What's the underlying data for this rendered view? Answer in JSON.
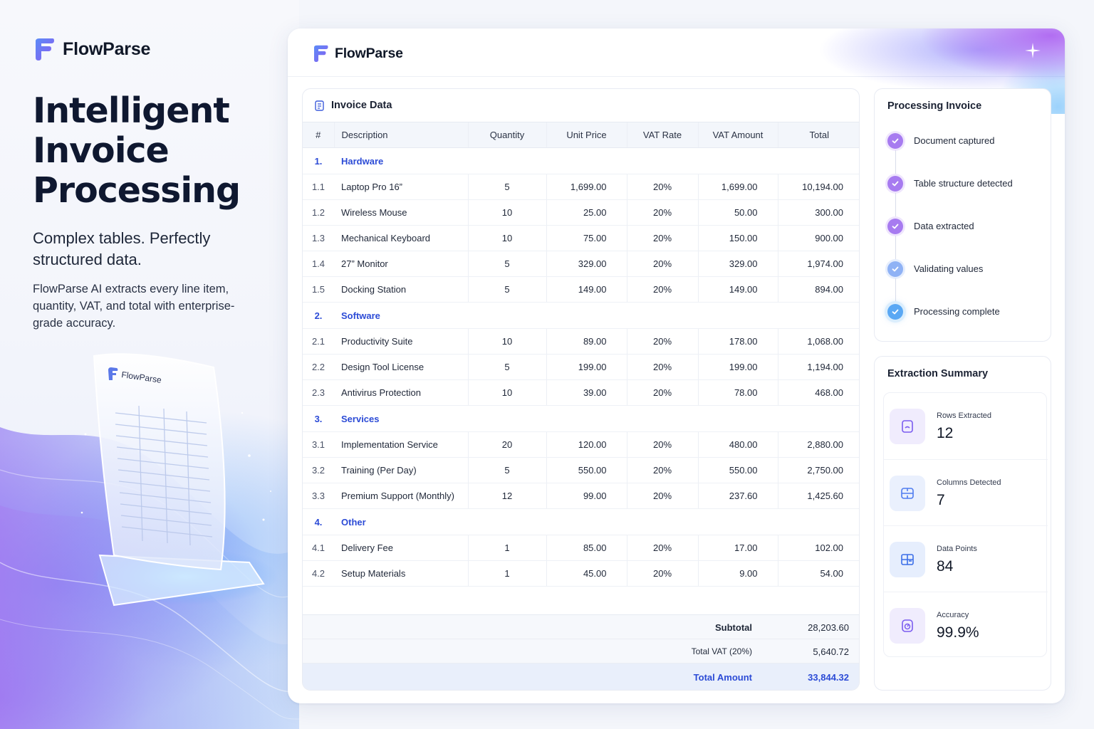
{
  "hero": {
    "brand": "FlowParse",
    "title_lines": [
      "Intelligent",
      "Invoice",
      "Processing"
    ],
    "subtitle": "Complex tables. Perfectly structured data.",
    "description": "FlowParse AI extracts every line item, quantity, VAT, and total with enterprise-grade accuracy.",
    "illustration_brand": "FlowParse"
  },
  "app": {
    "brand": "FlowParse"
  },
  "invoice": {
    "title": "Invoice Data",
    "columns": [
      "#",
      "Description",
      "Quantity",
      "Unit Price",
      "VAT Rate",
      "VAT Amount",
      "Total"
    ],
    "sections": [
      {
        "num": "1.",
        "name": "Hardware",
        "rows": [
          [
            "1.1",
            "Laptop Pro 16”",
            "5",
            "1,699.00",
            "20%",
            "1,699.00",
            "10,194.00"
          ],
          [
            "1.2",
            "Wireless Mouse",
            "10",
            "25.00",
            "20%",
            "50.00",
            "300.00"
          ],
          [
            "1.3",
            "Mechanical Keyboard",
            "10",
            "75.00",
            "20%",
            "150.00",
            "900.00"
          ],
          [
            "1.4",
            "27” Monitor",
            "5",
            "329.00",
            "20%",
            "329.00",
            "1,974.00"
          ],
          [
            "1.5",
            "Docking Station",
            "5",
            "149.00",
            "20%",
            "149.00",
            "894.00"
          ]
        ]
      },
      {
        "num": "2.",
        "name": "Software",
        "rows": [
          [
            "2.1",
            "Productivity Suite",
            "10",
            "89.00",
            "20%",
            "178.00",
            "1,068.00"
          ],
          [
            "2.2",
            "Design Tool License",
            "5",
            "199.00",
            "20%",
            "199.00",
            "1,194.00"
          ],
          [
            "2.3",
            "Antivirus Protection",
            "10",
            "39.00",
            "20%",
            "78.00",
            "468.00"
          ]
        ]
      },
      {
        "num": "3.",
        "name": "Services",
        "rows": [
          [
            "3.1",
            "Implementation Service",
            "20",
            "120.00",
            "20%",
            "480.00",
            "2,880.00"
          ],
          [
            "3.2",
            "Training (Per Day)",
            "5",
            "550.00",
            "20%",
            "550.00",
            "2,750.00"
          ],
          [
            "3.3",
            "Premium Support (Monthly)",
            "12",
            "99.00",
            "20%",
            "237.60",
            "1,425.60"
          ]
        ]
      },
      {
        "num": "4.",
        "name": "Other",
        "rows": [
          [
            "4.1",
            "Delivery Fee",
            "1",
            "85.00",
            "20%",
            "17.00",
            "102.00"
          ],
          [
            "4.2",
            "Setup Materials",
            "1",
            "45.00",
            "20%",
            "9.00",
            "54.00"
          ]
        ]
      }
    ],
    "subtotal_label": "Subtotal",
    "subtotal_value": "28,203.60",
    "vat_label": "Total VAT (20%)",
    "vat_value": "5,640.72",
    "total_label": "Total Amount",
    "total_value": "33,844.32"
  },
  "processing": {
    "title": "Processing Invoice",
    "steps": [
      {
        "label": "Document captured",
        "state": "done",
        "icon": "check-icon"
      },
      {
        "label": "Table structure detected",
        "state": "done",
        "icon": "check-icon"
      },
      {
        "label": "Data extracted",
        "state": "done",
        "icon": "check-icon"
      },
      {
        "label": "Validating values",
        "state": "done",
        "icon": "check-icon"
      },
      {
        "label": "Processing complete",
        "state": "active",
        "icon": "check-icon"
      }
    ]
  },
  "summary": {
    "title": "Extraction Summary",
    "metrics": [
      {
        "label": "Rows Extracted",
        "value": "12",
        "icon": "rows-icon"
      },
      {
        "label": "Columns Detected",
        "value": "7",
        "icon": "columns-icon"
      },
      {
        "label": "Data Points",
        "value": "84",
        "icon": "grid-icon"
      },
      {
        "label": "Accuracy",
        "value": "99.9%",
        "icon": "gauge-icon"
      }
    ]
  },
  "colors": {
    "accent_blue": "#2c4bd6",
    "step_purple": "#a77bf0",
    "step_blue": "#8fb2f5",
    "step_active": "#5aa8f4"
  }
}
